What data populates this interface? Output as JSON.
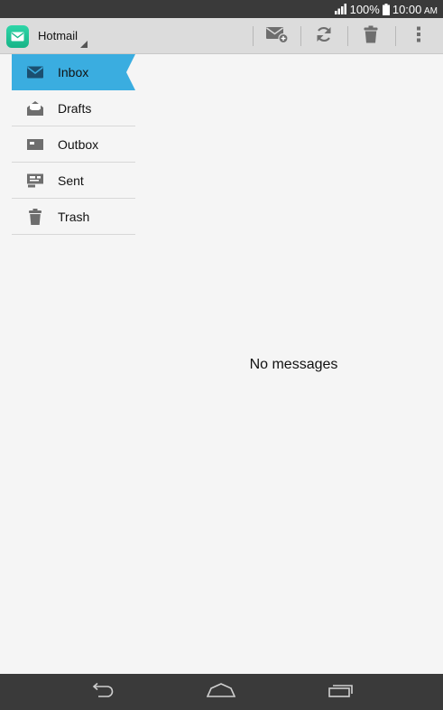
{
  "status_bar": {
    "battery": "100%",
    "time": "10:00",
    "ampm": "AM"
  },
  "action_bar": {
    "account": "Hotmail"
  },
  "folders": [
    {
      "label": "Inbox",
      "icon": "inbox-icon",
      "active": true
    },
    {
      "label": "Drafts",
      "icon": "drafts-icon",
      "active": false
    },
    {
      "label": "Outbox",
      "icon": "outbox-icon",
      "active": false
    },
    {
      "label": "Sent",
      "icon": "sent-icon",
      "active": false
    },
    {
      "label": "Trash",
      "icon": "trash-icon",
      "active": false
    }
  ],
  "main": {
    "empty_text": "No messages"
  },
  "colors": {
    "accent": "#3aade0",
    "app_icon": "#1fc497",
    "status_bar": "#3a3a3a",
    "action_bar": "#dcdcdc"
  }
}
